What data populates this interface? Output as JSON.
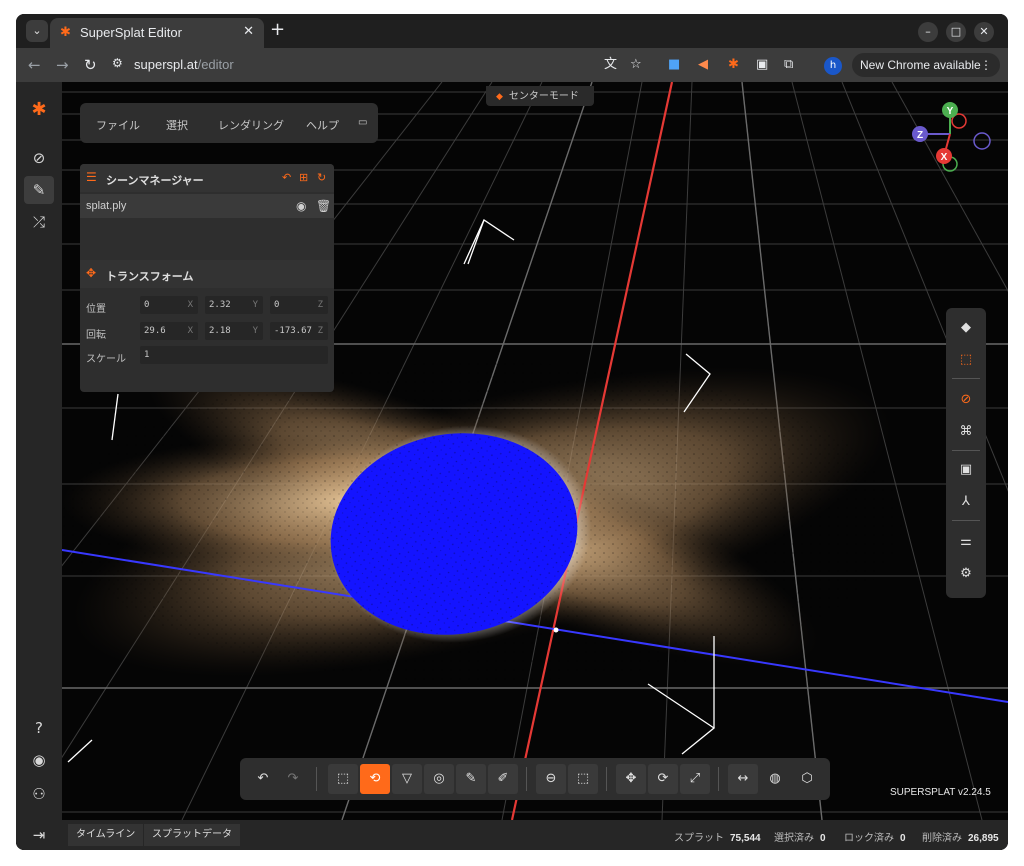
{
  "browser": {
    "tab_title": "SuperSplat Editor",
    "url_host": "superspl.at",
    "url_path": "/editor",
    "update_label": "New Chrome available",
    "profile_initial": "h"
  },
  "app": {
    "center_mode_label": "センターモード",
    "menu": [
      "ファイル",
      "選択",
      "レンダリング",
      "ヘルプ"
    ],
    "scene_manager": {
      "title": "シーンマネージャー",
      "splat_name": "splat.ply"
    },
    "transform": {
      "title": "トランスフォーム",
      "position_label": "位置",
      "rotation_label": "回転",
      "scale_label": "スケール",
      "position": {
        "x": "0",
        "y": "2.32",
        "z": "0"
      },
      "rotation": {
        "x": "29.6",
        "y": "2.18",
        "z": "-173.67"
      },
      "scale": "1",
      "axis_x": "X",
      "axis_y": "Y",
      "axis_z": "Z"
    },
    "gizmo": {
      "x": "X",
      "y": "Y",
      "z": "Z"
    },
    "version": "SUPERSPLAT v2.24.5",
    "status": {
      "timeline_tab": "タイムライン",
      "splat_data_tab": "スプラットデータ",
      "splats_label": "スプラット",
      "splats_value": "75,544",
      "selected_label": "選択済み",
      "selected_value": "0",
      "locked_label": "ロック済み",
      "locked_value": "0",
      "deleted_label": "削除済み",
      "deleted_value": "26,895"
    }
  },
  "colors": {
    "accent": "#ff6a1a",
    "axis_x": "#e53935",
    "axis_y": "#4caf50",
    "axis_z": "#6a5acd",
    "selection_blue": "#1414ff"
  }
}
